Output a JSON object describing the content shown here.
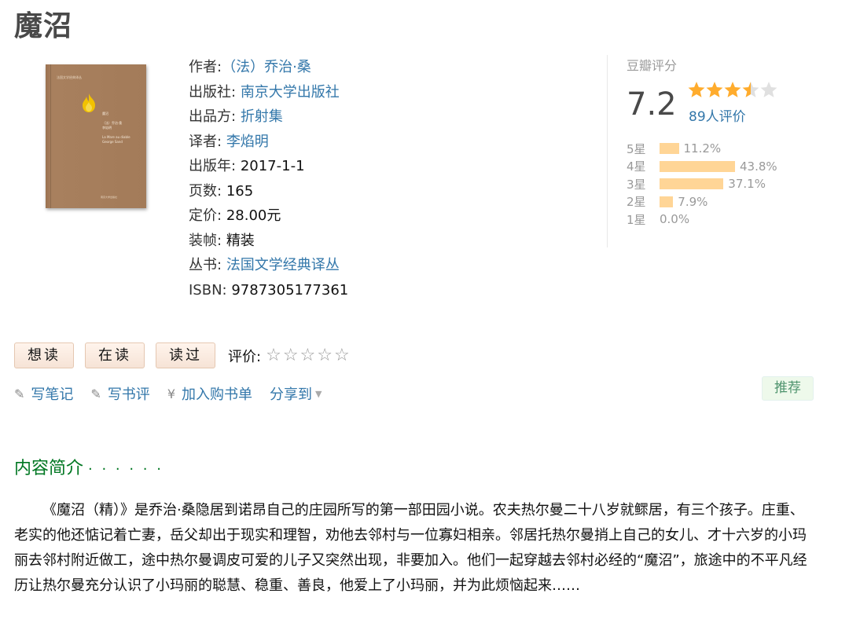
{
  "book": {
    "title": "魔沼",
    "cover": {
      "series_tag": "法国文学经典译丛",
      "title": "魔沼",
      "author": "（法）乔治·桑",
      "translator": "李焰明",
      "title_en": "La Mare au diable",
      "author_en": "George Sand",
      "publisher": "南京大学出版社"
    }
  },
  "info": [
    {
      "label": "作者:",
      "value": "（法）乔治·桑",
      "link": true
    },
    {
      "label": "出版社:",
      "value": "南京大学出版社",
      "link": true
    },
    {
      "label": "出品方:",
      "value": "折射集",
      "link": true
    },
    {
      "label": "译者:",
      "value": "李焰明",
      "link": true
    },
    {
      "label": "出版年:",
      "value": "2017-1-1",
      "link": false
    },
    {
      "label": "页数:",
      "value": "165",
      "link": false
    },
    {
      "label": "定价:",
      "value": "28.00元",
      "link": false
    },
    {
      "label": "装帧:",
      "value": "精装",
      "link": false
    },
    {
      "label": "丛书:",
      "value": "法国文学经典译丛",
      "link": true
    },
    {
      "label": "ISBN:",
      "value": "9787305177361",
      "link": false
    }
  ],
  "rating": {
    "title": "豆瓣评分",
    "score": "7.2",
    "stars_filled": 3.5,
    "stars_total": 5,
    "count": "89人评价",
    "distribution": [
      {
        "label": "5星",
        "pct": "11.2%",
        "value": 11.2
      },
      {
        "label": "4星",
        "pct": "43.8%",
        "value": 43.8
      },
      {
        "label": "3星",
        "pct": "37.1%",
        "value": 37.1
      },
      {
        "label": "2星",
        "pct": "7.9%",
        "value": 7.9
      },
      {
        "label": "1星",
        "pct": "0.0%",
        "value": 0.0
      }
    ]
  },
  "buttons": {
    "want": "想读",
    "reading": "在读",
    "read": "读过",
    "evaluate_label": "评价:"
  },
  "actions": {
    "note": "写笔记",
    "review": "写书评",
    "cart": "加入购书单",
    "share": "分享到",
    "recommend": "推荐"
  },
  "intro": {
    "heading": "内容简介",
    "dots": "· · · · · ·",
    "text": "《魔沼（精）》是乔治·桑隐居到诺昂自己的庄园所写的第一部田园小说。农夫热尔曼二十八岁就鳏居，有三个孩子。庄重、老实的他还惦记着亡妻，岳父却出于现实和理智，劝他去邻村与一位寡妇相亲。邻居托热尔曼捎上自己的女儿、才十六岁的小玛丽去邻村附近做工，途中热尔曼调皮可爱的儿子又突然出现，非要加入。他们一起穿越去邻村必经的“魔沼”，旅途中的不平凡经历让热尔曼充分认识了小玛丽的聪慧、稳重、善良，他爱上了小玛丽，并为此烦恼起来……"
  },
  "colors": {
    "link": "#3377aa",
    "green": "#007722",
    "star": "#ffac2d",
    "bar": "#ffd596"
  }
}
